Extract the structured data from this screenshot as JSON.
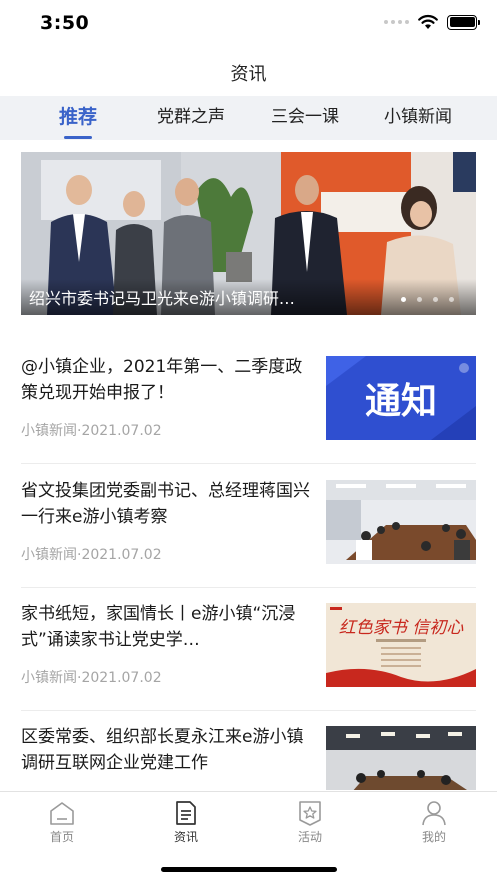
{
  "status_bar": {
    "time": "3:50"
  },
  "nav": {
    "title": "资讯"
  },
  "tabs": [
    {
      "label": "推荐",
      "active": true
    },
    {
      "label": "党群之声",
      "active": false
    },
    {
      "label": "三会一课",
      "active": false
    },
    {
      "label": "小镇新闻",
      "active": false
    }
  ],
  "banner": {
    "caption": "绍兴市委书记马卫光来e游小镇调研…",
    "dots_total": 4,
    "dots_active_index": 0
  },
  "news": [
    {
      "title": "@小镇企业，2021年第一、二季度政策兑现开始申报了！",
      "meta": "小镇新闻·2021.07.02",
      "thumb_text": "通知"
    },
    {
      "title": "省文投集团党委副书记、总经理蒋国兴一行来e游小镇考察",
      "meta": "小镇新闻·2021.07.02",
      "thumb_text": ""
    },
    {
      "title": "家书纸短，家国情长丨e游小镇“沉浸式”诵读家书让党史学…",
      "meta": "小镇新闻·2021.07.02",
      "thumb_text": "红色家书 信初心"
    },
    {
      "title": "区委常委、组织部长夏永江来e游小镇调研互联网企业党建工作",
      "meta": "",
      "thumb_text": ""
    }
  ],
  "bottom_nav": [
    {
      "label": "首页",
      "icon": "home-icon",
      "active": false
    },
    {
      "label": "资讯",
      "icon": "news-icon",
      "active": true
    },
    {
      "label": "活动",
      "icon": "activity-icon",
      "active": false
    },
    {
      "label": "我的",
      "icon": "profile-icon",
      "active": false
    }
  ],
  "colors": {
    "accent": "#3a63c9",
    "tab_bg": "#f0f2f5",
    "meta": "#a5a5a5",
    "notice_blue": "#2f4fd0"
  }
}
